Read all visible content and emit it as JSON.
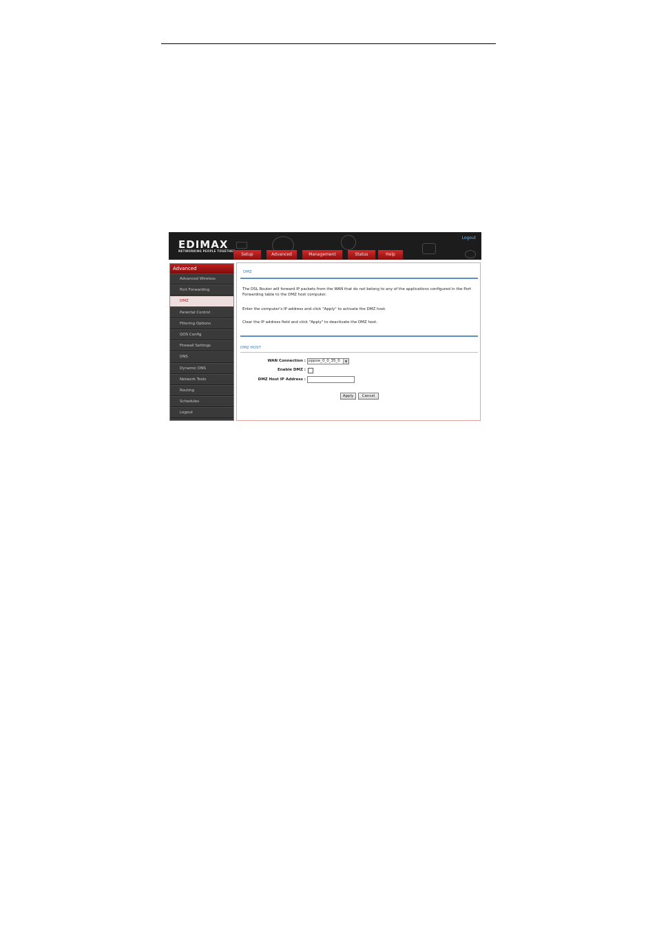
{
  "header": {
    "logo": "EDIMAX",
    "tagline": "NETWORKING PEOPLE TOGETHER",
    "user_link": "",
    "logout_link": "Logout"
  },
  "tabs": [
    {
      "label": "Setup"
    },
    {
      "label": "Advanced"
    },
    {
      "label": "Management"
    },
    {
      "label": "Status"
    },
    {
      "label": "Help"
    }
  ],
  "sidebar": {
    "heading": "Advanced",
    "items": [
      {
        "label": "Advanced Wireless"
      },
      {
        "label": "Port Forwarding"
      },
      {
        "label": "DMZ"
      },
      {
        "label": "Parental Control"
      },
      {
        "label": "Filtering Options"
      },
      {
        "label": "QOS Config"
      },
      {
        "label": "Firewall Settings"
      },
      {
        "label": "DNS"
      },
      {
        "label": "Dynamic DNS"
      },
      {
        "label": "Network Tools"
      },
      {
        "label": "Routing"
      },
      {
        "label": "Schedules"
      },
      {
        "label": "Logout"
      }
    ],
    "active_index": 2
  },
  "main": {
    "title": "DMZ",
    "description": "The DSL Router will forward IP packets from the WAN that do not belong to any of the applications configured in the Port Forwarding table to the DMZ host computer.",
    "instruction_enable": "Enter the computer's IP address and click \"Apply\" to activate the DMZ host.",
    "instruction_disable": "Clear the IP address field and click \"Apply\" to deactivate the DMZ host.",
    "section_title": "DMZ HOST",
    "form": {
      "wan_connection_label": "WAN Connection :",
      "wan_connection_value": "pppoe_0_0_35_0",
      "enable_dmz_label": "Enable DMZ :",
      "enable_dmz_checked": false,
      "host_ip_label": "DMZ Host IP Address :",
      "host_ip_value": "",
      "apply_label": "Apply",
      "cancel_label": "Cancel"
    }
  },
  "colors": {
    "brand_red": "#b0161c",
    "header_bg": "#1c1c1c",
    "link_blue": "#3c78b4"
  }
}
